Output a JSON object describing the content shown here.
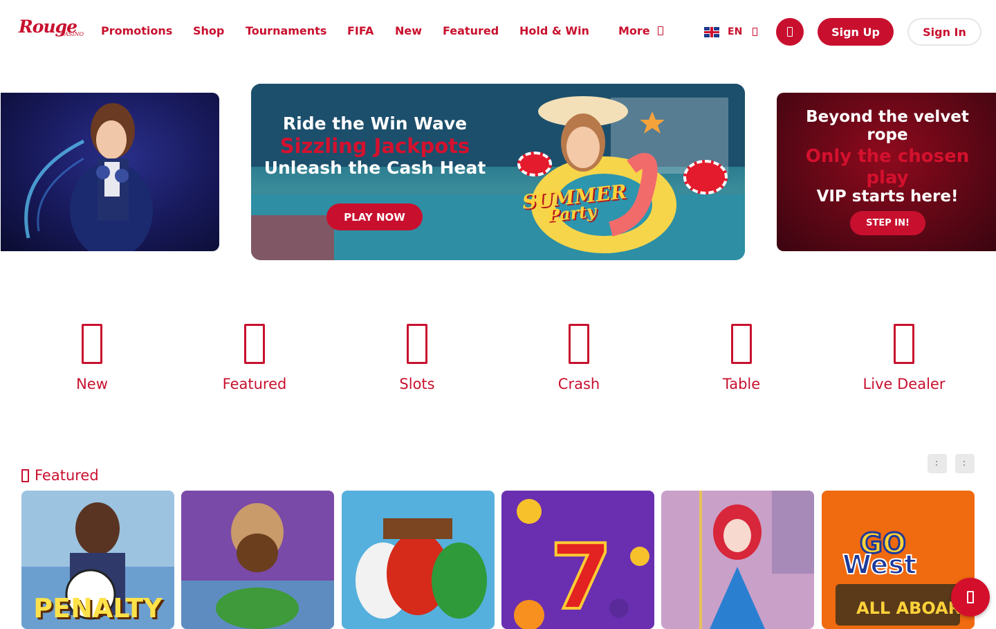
{
  "brand": {
    "name": "Rouge",
    "sub": "CASINO"
  },
  "nav": {
    "items": [
      "Promotions",
      "Shop",
      "Tournaments",
      "FIFA",
      "New",
      "Featured",
      "Hold & Win",
      "More"
    ],
    "language": "EN",
    "sign_up": "Sign Up",
    "sign_in": "Sign In"
  },
  "carousel": {
    "center": {
      "line1": "Ride the Win Wave",
      "line2": "Sizzling Jackpots",
      "line3": "Unleash the Cash Heat",
      "cta": "PLAY NOW",
      "logo_line1": "SUMMER",
      "logo_line2": "Party"
    },
    "right": {
      "line1": "Beyond the velvet rope",
      "line2": "Only the chosen play",
      "line3": "VIP starts here!",
      "cta": "STEP IN!"
    }
  },
  "categories": [
    "New",
    "Featured",
    "Slots",
    "Crash",
    "Table",
    "Live Dealer"
  ],
  "featured": {
    "heading": "Featured",
    "tiles": [
      {
        "title": "PENALTY",
        "bg": "#8fb7d9"
      },
      {
        "title": "",
        "bg": "#7a4aa8"
      },
      {
        "title": "",
        "bg": "#4aa6d6"
      },
      {
        "title": "",
        "bg": "#6a2fb0"
      },
      {
        "title": "",
        "bg": "#c98fb0"
      },
      {
        "title": "",
        "bg": "#f06a10"
      }
    ]
  },
  "colors": {
    "accent": "#c8102e",
    "button_text": "#ffffff",
    "neutral": "#e9e9e9"
  },
  "icons": {
    "nav_more": "chevron-down-icon",
    "lang_caret": "chevron-down-icon",
    "header_icon": "user-icon",
    "categories": [
      "new-icon",
      "star-icon",
      "slots-icon",
      "rocket-icon",
      "cards-icon",
      "dealer-icon"
    ],
    "featured_heading": "star-icon",
    "chat": "chat-icon"
  }
}
